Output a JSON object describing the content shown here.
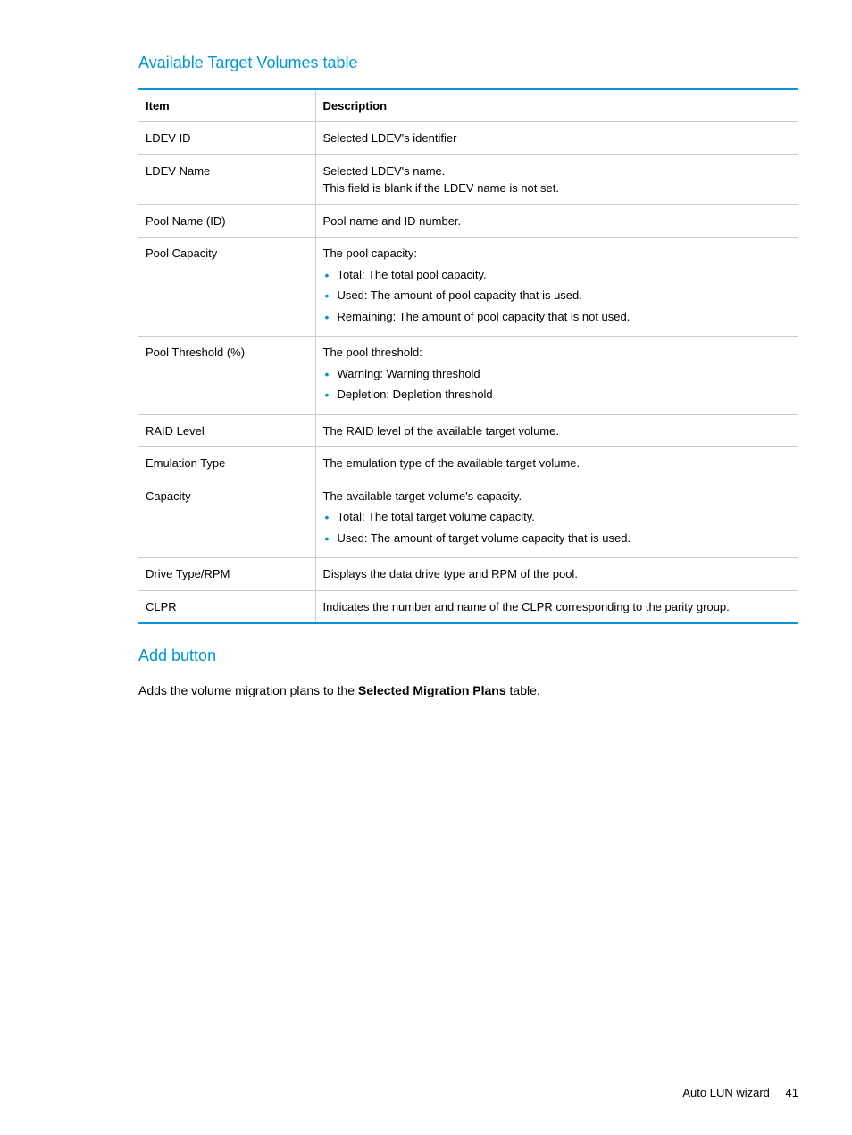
{
  "sections": {
    "table_title": "Available Target Volumes table",
    "add_title": "Add button",
    "add_desc_pre": "Adds the volume migration plans to the ",
    "add_desc_bold": "Selected Migration Plans",
    "add_desc_post": " table."
  },
  "table": {
    "headers": {
      "item": "Item",
      "description": "Description"
    },
    "rows": {
      "ldev_id": {
        "item": "LDEV ID",
        "desc": "Selected LDEV's identifier"
      },
      "ldev_name": {
        "item": "LDEV Name",
        "desc_line1": "Selected LDEV's name.",
        "desc_line2": "This field is blank if the LDEV name is not set."
      },
      "pool_name": {
        "item": "Pool Name (ID)",
        "desc": "Pool name and ID number."
      },
      "pool_capacity": {
        "item": "Pool Capacity",
        "desc": "The pool capacity:",
        "bullets": {
          "b1": "Total: The total pool capacity.",
          "b2": "Used: The amount of pool capacity that is used.",
          "b3": "Remaining: The amount of pool capacity that is not used."
        }
      },
      "pool_threshold": {
        "item": "Pool Threshold (%)",
        "desc": "The pool threshold:",
        "bullets": {
          "b1": "Warning: Warning threshold",
          "b2": "Depletion: Depletion threshold"
        }
      },
      "raid_level": {
        "item": "RAID Level",
        "desc": "The RAID level of the available target volume."
      },
      "emulation_type": {
        "item": "Emulation Type",
        "desc": "The emulation type of the available target volume."
      },
      "capacity": {
        "item": "Capacity",
        "desc": "The available target volume's capacity.",
        "bullets": {
          "b1": "Total: The total target volume capacity.",
          "b2": "Used: The amount of target volume capacity that is used."
        }
      },
      "drive_type": {
        "item": "Drive Type/RPM",
        "desc": "Displays the data drive type and RPM of the pool."
      },
      "clpr": {
        "item": "CLPR",
        "desc": "Indicates the number and name of the CLPR corresponding to the parity group."
      }
    }
  },
  "footer": {
    "text": "Auto LUN wizard",
    "page": "41"
  }
}
